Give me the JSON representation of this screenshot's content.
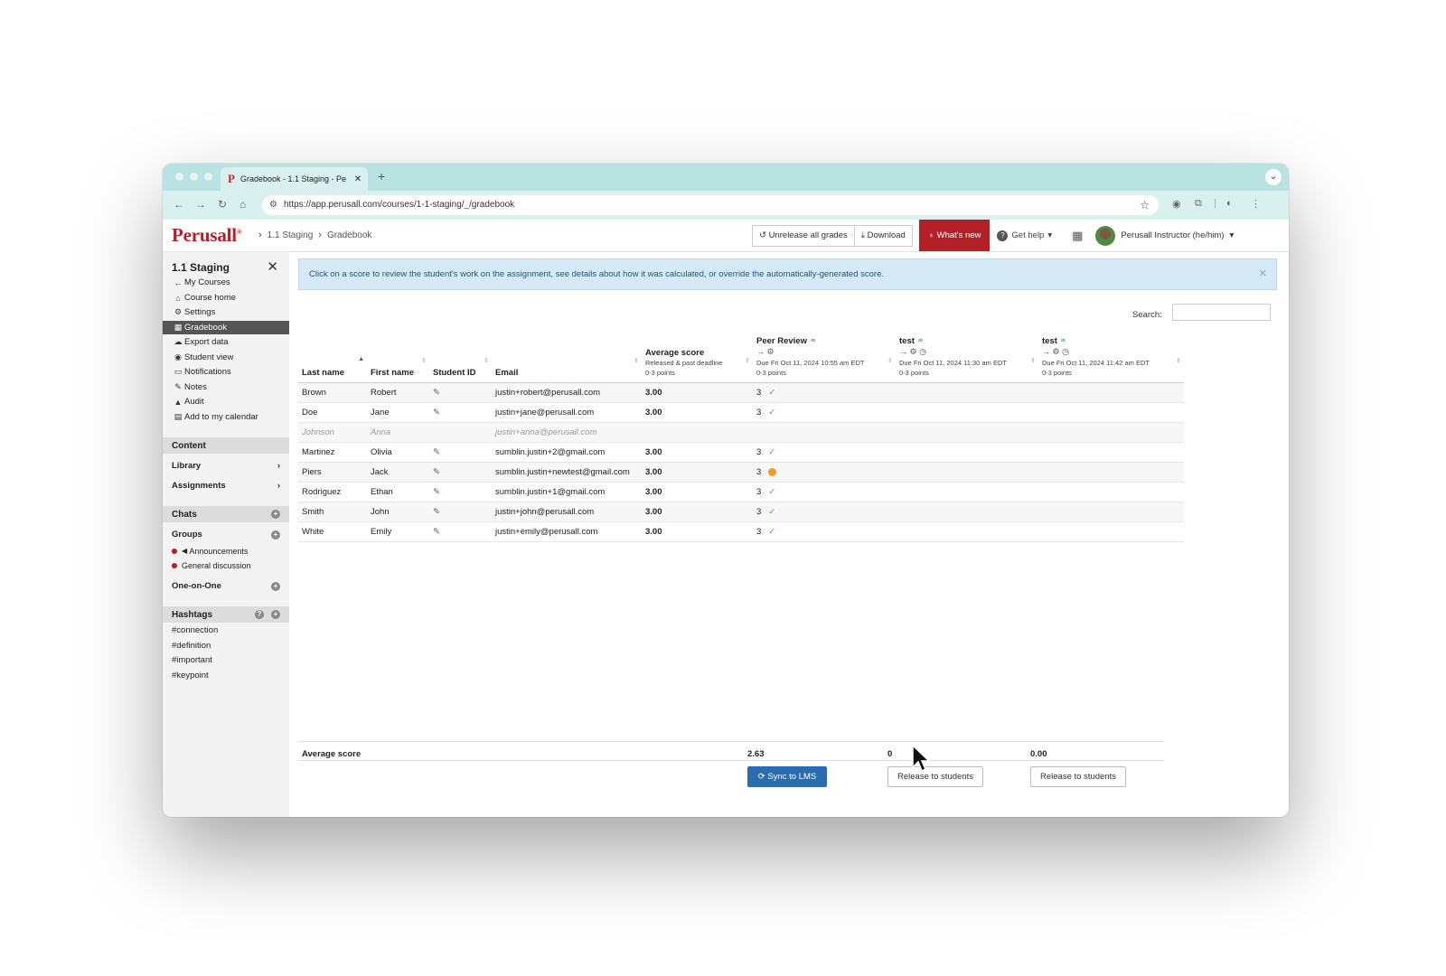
{
  "browser": {
    "tab_title": "Gradebook - 1.1 Staging - Pe",
    "url": "https://app.perusall.com/courses/1-1-staging/_/gradebook"
  },
  "header": {
    "logo": "Perusall",
    "logo_mark": "®",
    "breadcrumbs": [
      "1.1 Staging",
      "Gradebook"
    ],
    "unrelease_label": "Unrelease all grades",
    "download_label": "Download",
    "whats_new_label": "What's new",
    "get_help_label": "Get help",
    "user_label": "Perusall Instructor (he/him)"
  },
  "sidebar": {
    "course_title": "1.1 Staging",
    "nav": [
      {
        "label": "My Courses",
        "icon": "arrow-left-icon"
      },
      {
        "label": "Course home",
        "icon": "home-icon"
      },
      {
        "label": "Settings",
        "icon": "gear-icon"
      },
      {
        "label": "Gradebook",
        "icon": "table-icon"
      },
      {
        "label": "Export data",
        "icon": "cloud-download-icon"
      },
      {
        "label": "Student view",
        "icon": "eye-icon"
      },
      {
        "label": "Notifications",
        "icon": "inbox-icon"
      },
      {
        "label": "Notes",
        "icon": "pencil-icon"
      },
      {
        "label": "Audit",
        "icon": "warning-icon"
      },
      {
        "label": "Add to my calendar",
        "icon": "calendar-icon"
      }
    ],
    "content_label": "Content",
    "library_label": "Library",
    "assignments_label": "Assignments",
    "chats_label": "Chats",
    "groups_label": "Groups",
    "groups": [
      "Announcements",
      "General discussion"
    ],
    "one_on_one_label": "One-on-One",
    "hashtags_label": "Hashtags",
    "hashtags": [
      "#connection",
      "#definition",
      "#important",
      "#keypoint"
    ]
  },
  "main": {
    "alert": "Click on a score to review the student's work on the assignment, see details about how it was calculated, or override the automatically-generated score.",
    "search_label": "Search:",
    "columns": {
      "last_name": "Last name",
      "first_name": "First name",
      "student_id": "Student ID",
      "email": "Email",
      "average": "Average score",
      "average_sub1": "Released & past deadline",
      "average_sub2": "0-3 points",
      "a1_title": "Peer Review",
      "a1_due": "Due Fri Oct 11, 2024 10:55 am EDT",
      "a1_points": "0-3 points",
      "a2_title": "test",
      "a2_due": "Due Fri Oct 11, 2024 11:30 am EDT",
      "a2_points": "0-3 points",
      "a3_title": "test",
      "a3_due": "Due Fri Oct 11, 2024 11:42 am EDT",
      "a3_points": "0-3 points"
    },
    "rows": [
      {
        "last": "Brown",
        "first": "Robert",
        "email": "justin+robert@perusall.com",
        "avg": "3.00",
        "pr": "3"
      },
      {
        "last": "Doe",
        "first": "Jane",
        "email": "justin+jane@perusall.com",
        "avg": "3.00",
        "pr": "3"
      },
      {
        "last": "Johnson",
        "first": "Anna",
        "email": "justin+anna@perusall.com",
        "avg": "",
        "pr": ""
      },
      {
        "last": "Martinez",
        "first": "Olivia",
        "email": "sumblin.justin+2@gmail.com",
        "avg": "3.00",
        "pr": "3"
      },
      {
        "last": "Piers",
        "first": "Jack",
        "email": "sumblin.justin+newtest@gmail.com",
        "avg": "3.00",
        "pr": "3"
      },
      {
        "last": "Rodriguez",
        "first": "Ethan",
        "email": "sumblin.justin+1@gmail.com",
        "avg": "3.00",
        "pr": "3"
      },
      {
        "last": "Smith",
        "first": "John",
        "email": "justin+john@perusall.com",
        "avg": "3.00",
        "pr": "3"
      },
      {
        "last": "White",
        "first": "Emily",
        "email": "justin+emily@perusall.com",
        "avg": "3.00",
        "pr": "3"
      }
    ],
    "footer": {
      "label": "Average score",
      "a1_avg": "2.63",
      "a2_avg": "0",
      "a3_avg": "0.00",
      "sync_label": "Sync to LMS",
      "release_label": "Release to students"
    }
  },
  "colors": {
    "brand": "#b4202a",
    "primary": "#2a6cb2",
    "tabstrip": "#b9e3e0"
  }
}
